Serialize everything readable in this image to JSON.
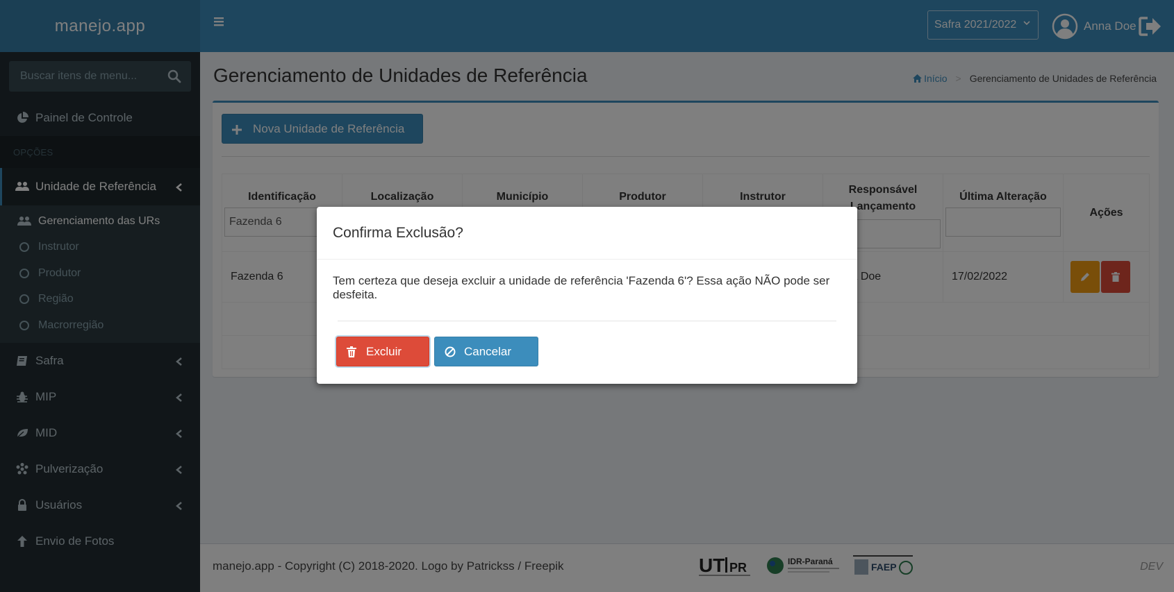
{
  "app": {
    "title": "manejo.app"
  },
  "sidebar": {
    "search_placeholder": "Buscar itens de menu...",
    "dashboard": "Painel de Controle",
    "section_header": "OPÇÕES",
    "active_item": "Unidade de Referência",
    "sub_items": [
      {
        "label": "Gerenciamento das URs",
        "icon": "users-icon"
      },
      {
        "label": "Instrutor",
        "icon": "circle-icon"
      },
      {
        "label": "Produtor",
        "icon": "circle-icon"
      },
      {
        "label": "Região",
        "icon": "circle-icon"
      },
      {
        "label": "Macrorregião",
        "icon": "circle-icon"
      }
    ],
    "items": [
      {
        "label": "Safra",
        "icon": "book-icon"
      },
      {
        "label": "MIP",
        "icon": "bug-icon"
      },
      {
        "label": "MID",
        "icon": "leaf-icon"
      },
      {
        "label": "Pulverização",
        "icon": "spray-icon"
      },
      {
        "label": "Usuários",
        "icon": "user-icon"
      },
      {
        "label": "Envio de Fotos",
        "icon": "arrow-up-icon"
      }
    ]
  },
  "header": {
    "safra_selected": "Safra 2021/2022",
    "user_name": "Anna Doe"
  },
  "page": {
    "title": "Gerenciamento de Unidades de Referência",
    "breadcrumb_home": "Início",
    "breadcrumb_current": "Gerenciamento de Unidades de Referência",
    "new_button": "Nova Unidade de Referência"
  },
  "table": {
    "headers": [
      "Identificação",
      "Localização",
      "Município",
      "Produtor",
      "Instrutor",
      "Responsável Lançamento",
      "Última Alteração",
      "Ações"
    ],
    "filter_identificacao": "Fazenda 6",
    "row": {
      "identificacao": "Fazenda 6",
      "responsavel": "Anna Doe",
      "ultima_alteracao": "17/02/2022"
    }
  },
  "modal": {
    "title": "Confirma Exclusão?",
    "message": "Tem certeza que deseja excluir a unidade de referência 'Fazenda 6'? Essa ação NÃO pode ser desfeita.",
    "confirm_label": "Excluir",
    "cancel_label": "Cancelar"
  },
  "footer": {
    "copyright": "manejo.app - Copyright (C) 2018-2020. Logo by Patrickss / Freepik",
    "env": "DEV",
    "logo_utfpr": "UTFPR",
    "logo_idr": "IDR-Paraná",
    "logo_faep": "FAEP"
  },
  "colors": {
    "primary": "#3c8dbc",
    "danger": "#dd4b39",
    "warning": "#f39c12",
    "sidebar_bg": "#222d32"
  }
}
